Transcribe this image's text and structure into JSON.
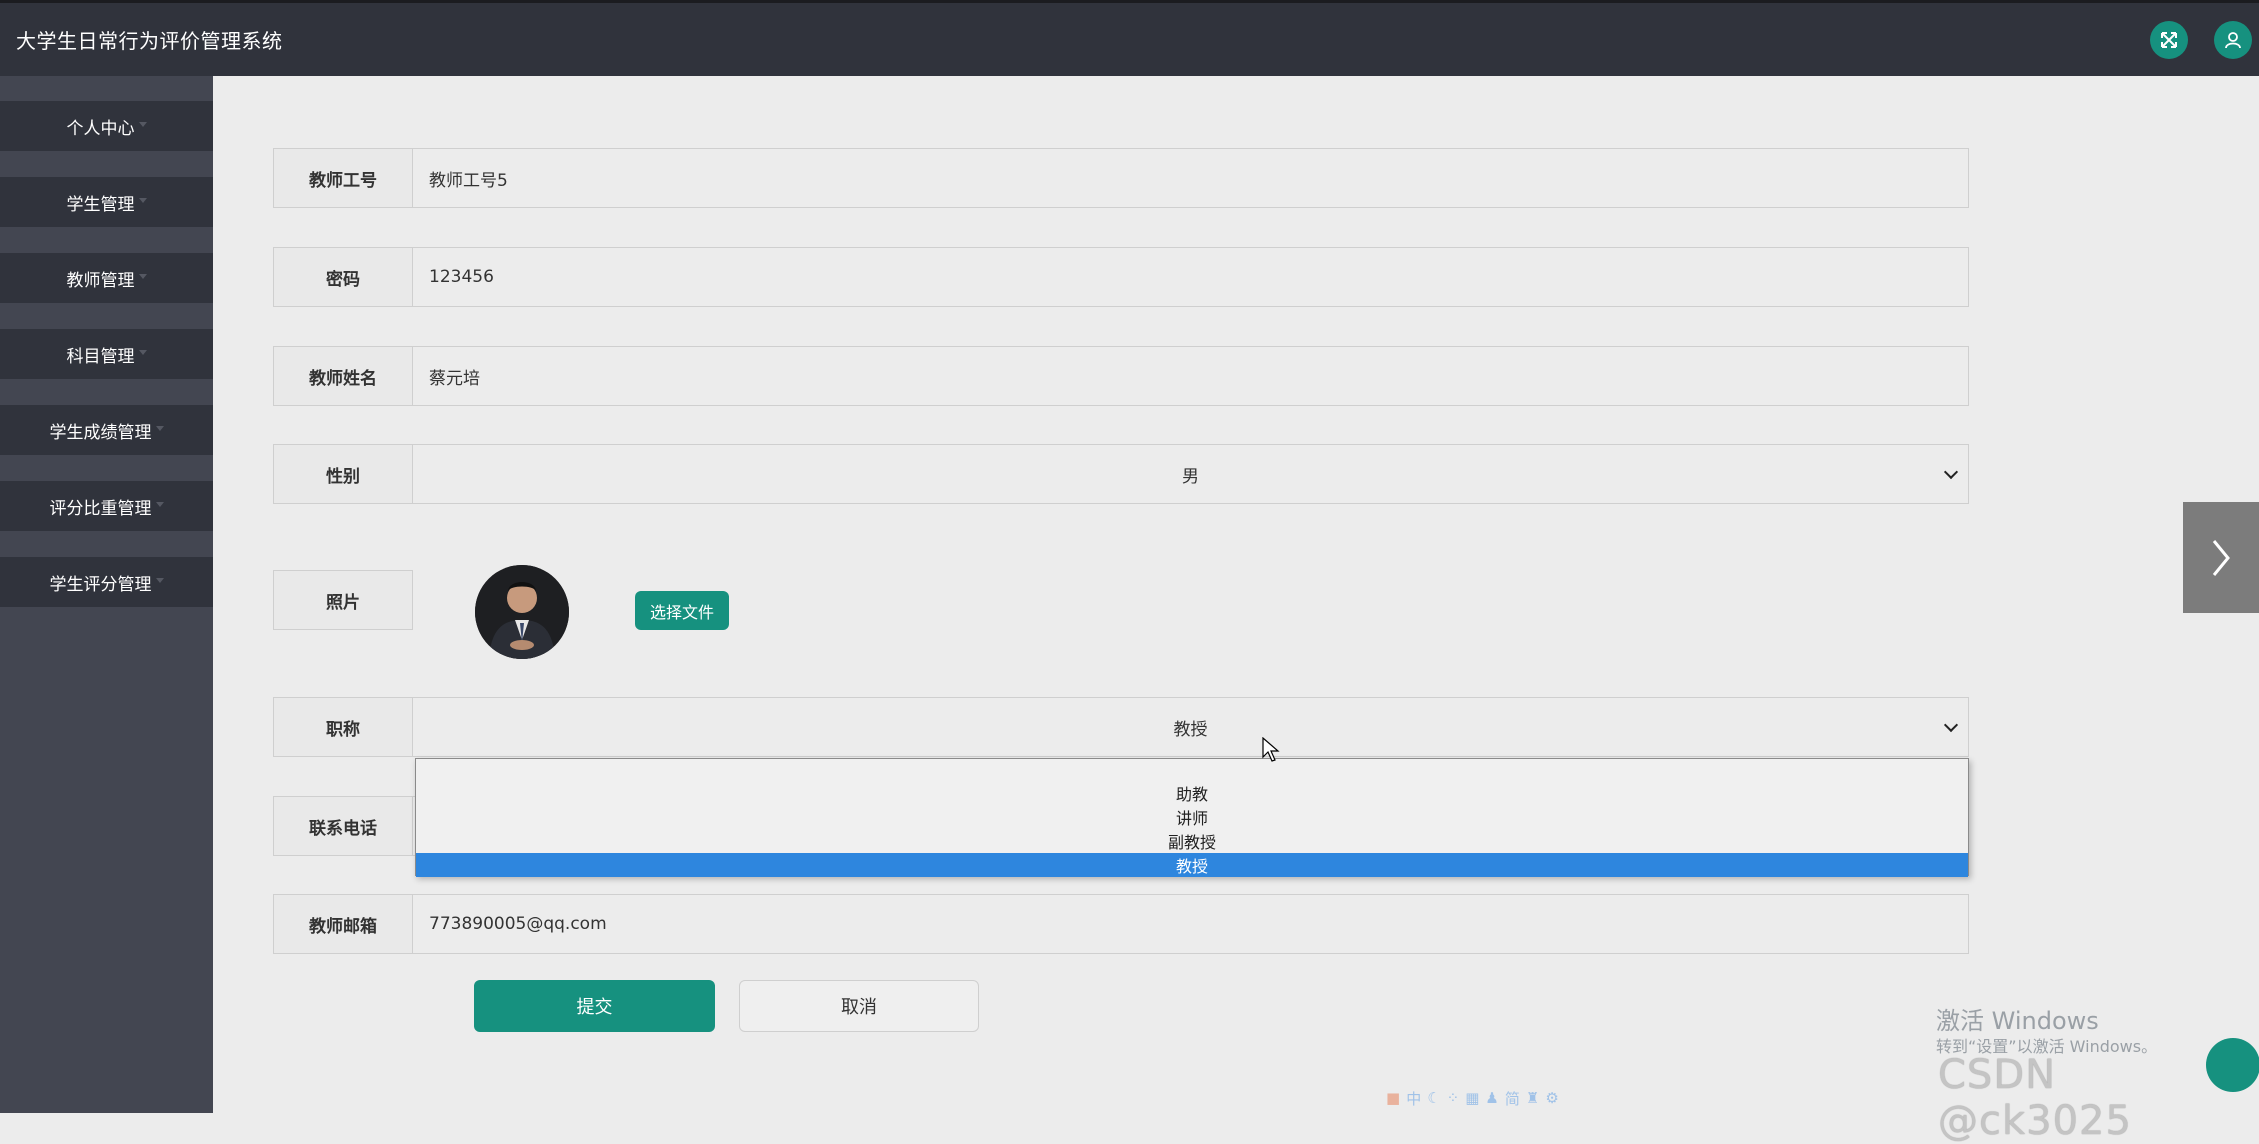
{
  "app": {
    "title": "大学生日常行为评价管理系统",
    "icons": [
      "expand-icon",
      "user-icon"
    ],
    "accent_color": "#16917f"
  },
  "sidebar": {
    "items": [
      {
        "label": "个人中心"
      },
      {
        "label": "学生管理"
      },
      {
        "label": "教师管理"
      },
      {
        "label": "科目管理"
      },
      {
        "label": "学生成绩管理"
      },
      {
        "label": "评分比重管理"
      },
      {
        "label": "学生评分管理"
      }
    ]
  },
  "form": {
    "teacher_id": {
      "label": "教师工号",
      "value": "教师工号5"
    },
    "password": {
      "label": "密码",
      "value": "123456"
    },
    "teacher_name": {
      "label": "教师姓名",
      "value": "蔡元培"
    },
    "gender": {
      "label": "性别",
      "value": "男"
    },
    "photo": {
      "label": "照片",
      "button": "选择文件"
    },
    "title": {
      "label": "职称",
      "value": "教授",
      "options": [
        "助教",
        "讲师",
        "副教授",
        "教授"
      ],
      "selected_index": 3
    },
    "phone": {
      "label": "联系电话",
      "value": ""
    },
    "email": {
      "label": "教师邮箱",
      "value": "773890005@qq.com"
    },
    "submit_label": "提交",
    "cancel_label": "取消"
  },
  "overlay": {
    "windows_activate": "激活 Windows",
    "windows_activate_sub": "转到“设置”以激活 Windows。",
    "csdn_watermark": "CSDN @ck3025",
    "ime_items": [
      "中",
      "简"
    ]
  }
}
